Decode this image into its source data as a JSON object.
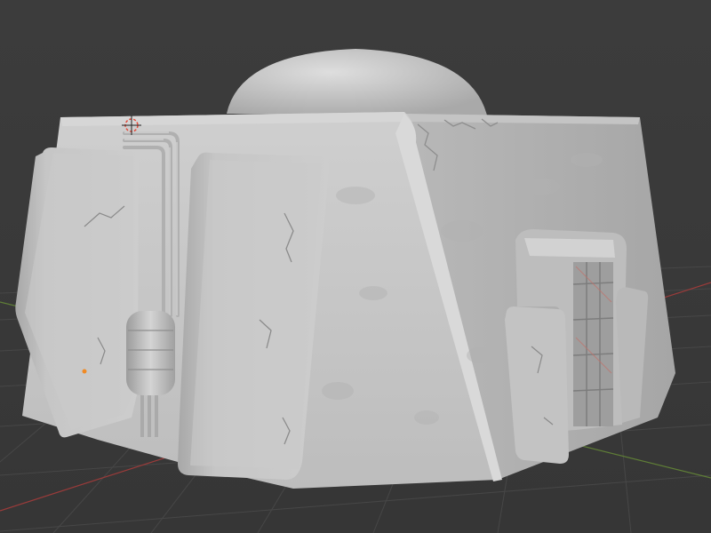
{
  "viewport": {
    "editor": "3D Viewport",
    "shading": "solid",
    "background_color": "#3d3d3d",
    "grid_color": "#4a4a4a",
    "axis_x_color": "#c0403f",
    "axis_y_color": "#7aa83a"
  },
  "scene": {
    "object": {
      "kind": "sculpted-dome-building",
      "material_color": "#c8c8c8",
      "features": [
        "dome-roof",
        "front-buttress-left",
        "front-buttress-right",
        "pipe-bundle",
        "pipe-tank",
        "side-doorway",
        "door-grate"
      ]
    },
    "cursor_3d": "3d-cursor-icon",
    "origin_marker": "object-origin-icon"
  }
}
